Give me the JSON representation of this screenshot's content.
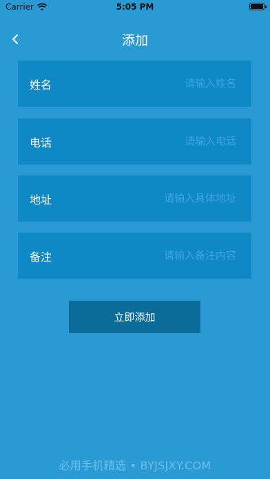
{
  "status_bar": {
    "carrier": "Carrier",
    "time": "5:05 PM"
  },
  "header": {
    "title": "添加"
  },
  "form": {
    "fields": [
      {
        "label": "姓名",
        "placeholder": "请输入姓名",
        "value": ""
      },
      {
        "label": "电话",
        "placeholder": "请输入电话",
        "value": ""
      },
      {
        "label": "地址",
        "placeholder": "请输入具体地址",
        "value": ""
      },
      {
        "label": "备注",
        "placeholder": "请输入备注内容",
        "value": ""
      }
    ],
    "submit_label": "立即添加"
  },
  "watermark": "必用手机精选 • BYJSJXY.COM",
  "colors": {
    "background": "#2a9ad4",
    "field_bg": "#0f88c6",
    "button_bg": "#0b6b99",
    "placeholder": "#3ea6db"
  }
}
